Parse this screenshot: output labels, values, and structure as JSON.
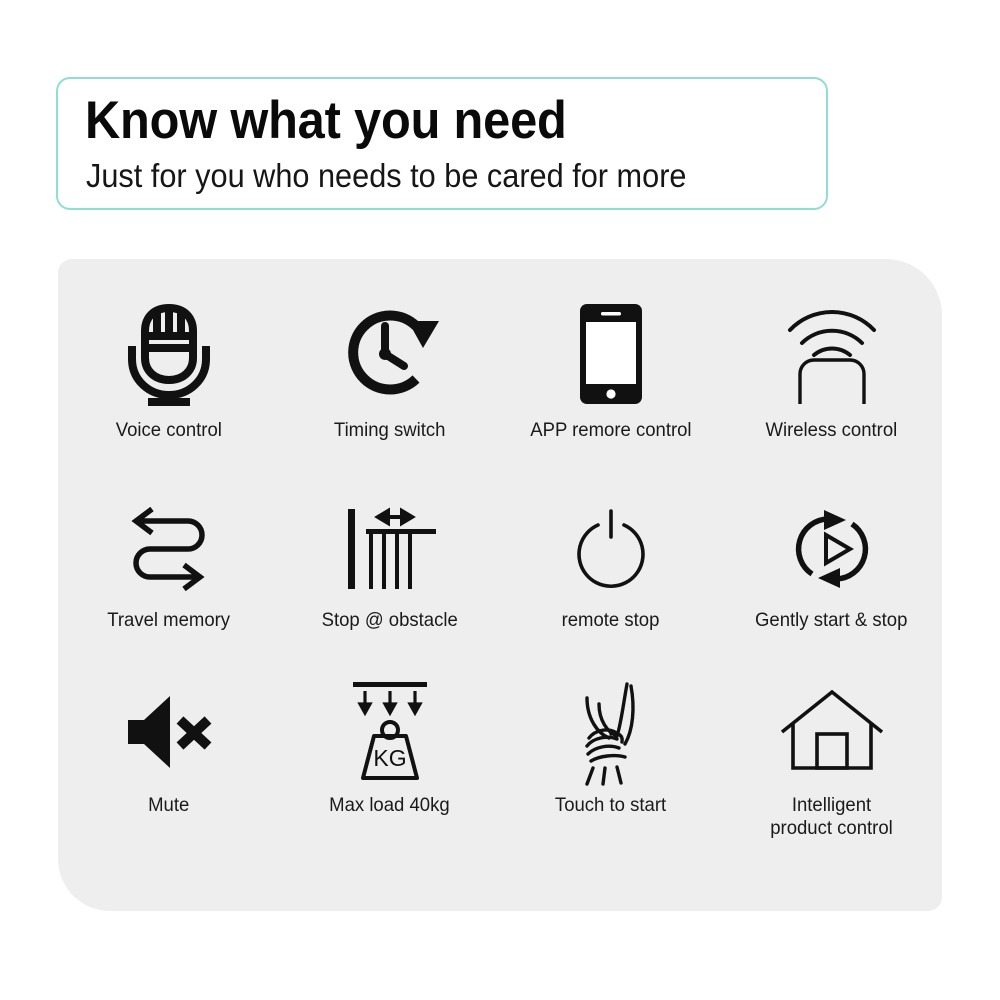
{
  "header": {
    "title": "Know what you need",
    "subtitle": "Just for you who needs to be cared for more",
    "border_color": "#8fded2"
  },
  "panel": {
    "background_color": "#eeeeee"
  },
  "features": [
    {
      "icon": "microphone-icon",
      "label": "Voice control"
    },
    {
      "icon": "clock-arrow-icon",
      "label": "Timing switch"
    },
    {
      "icon": "smartphone-icon",
      "label": "APP remore control"
    },
    {
      "icon": "wireless-signal-icon",
      "label": "Wireless control"
    },
    {
      "icon": "s-curve-arrows-icon",
      "label": "Travel memory"
    },
    {
      "icon": "curtain-obstacle-icon",
      "label": "Stop @ obstacle"
    },
    {
      "icon": "power-icon",
      "label": "remote stop"
    },
    {
      "icon": "cycle-play-icon",
      "label": "Gently start & stop"
    },
    {
      "icon": "mute-speaker-icon",
      "label": "Mute"
    },
    {
      "icon": "weight-kg-icon",
      "label": "Max load 40kg"
    },
    {
      "icon": "hand-curtain-icon",
      "label": "Touch to start"
    },
    {
      "icon": "house-icon",
      "label": "Intelligent\nproduct control"
    }
  ],
  "icon_text": {
    "weight_unit": "KG"
  }
}
